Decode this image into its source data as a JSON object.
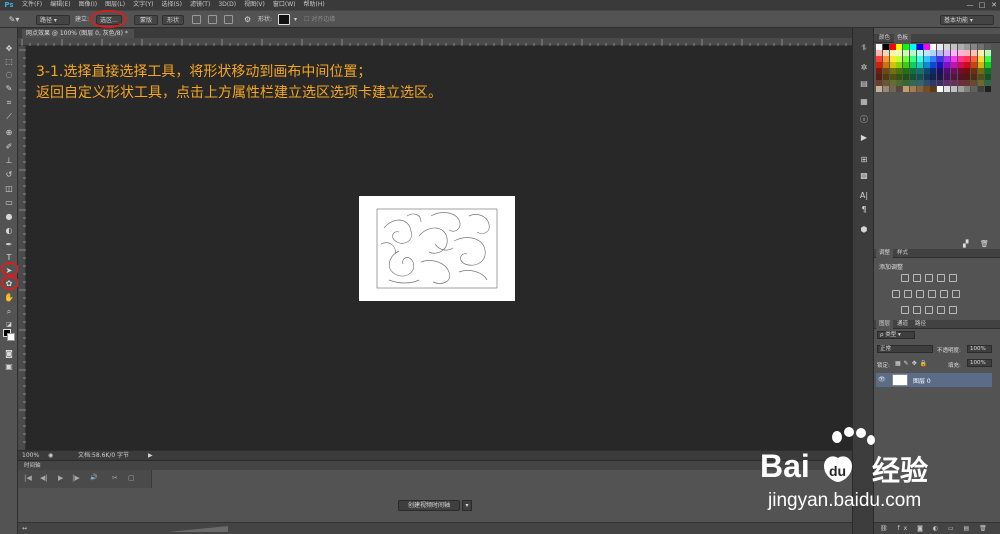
{
  "app": {
    "logo": "Ps",
    "menu": [
      "文件(F)",
      "编辑(E)",
      "图像(I)",
      "图层(L)",
      "文字(Y)",
      "选择(S)",
      "滤镜(T)",
      "3D(D)",
      "视图(V)",
      "窗口(W)",
      "帮助(H)"
    ],
    "window_controls": [
      "—",
      "□",
      "✕"
    ]
  },
  "options_bar": {
    "mode_value": "路径",
    "make_label": "建立:",
    "selection_button": "选区...",
    "mask_button": "蒙版",
    "shape_button": "形状",
    "shape_label": "形状:",
    "align_edges": "对齐边缘",
    "workspace": "基本功能"
  },
  "document": {
    "tab_title": "网点效果 @ 100% (图层 0, 灰色/8) *",
    "zoom": "100%",
    "doc_info": "文档:58.6K/0 字节",
    "status_arrow": "▶"
  },
  "instructions": {
    "line1": "3-1.选择直接选择工具，将形状移动到画布中间位置；",
    "line2": "返回自定义形状工具，点击上方属性栏建立选区选项卡建立选区。"
  },
  "timeline": {
    "tab": "时间轴",
    "create_button": "创建视频时间轴",
    "controls": [
      "|◀",
      "◀|",
      "▶",
      "|▶",
      "🔊",
      "✂",
      "▢"
    ]
  },
  "panels": {
    "color_tabs": [
      "颜色",
      "色板"
    ],
    "adjust_tabs": [
      "调整",
      "样式"
    ],
    "adjust_title": "添加调整",
    "layers_tabs": [
      "图层",
      "通道",
      "路径"
    ],
    "kind_label": "ρ 类型",
    "blend_mode": "正常",
    "opacity_label": "不透明度:",
    "opacity_value": "100%",
    "lock_label": "锁定:",
    "fill_label": "填充:",
    "fill_value": "100%",
    "layer_name": "图层 0",
    "layer_eye": "👁"
  },
  "watermark": {
    "brand": "Bai",
    "brand_cn": "经验",
    "url": "jingyan.baidu.com"
  },
  "colors": {
    "accent_orange": "#f5a623",
    "annotation_red": "#d71f1f",
    "layer_selected": "#5b6c86"
  }
}
